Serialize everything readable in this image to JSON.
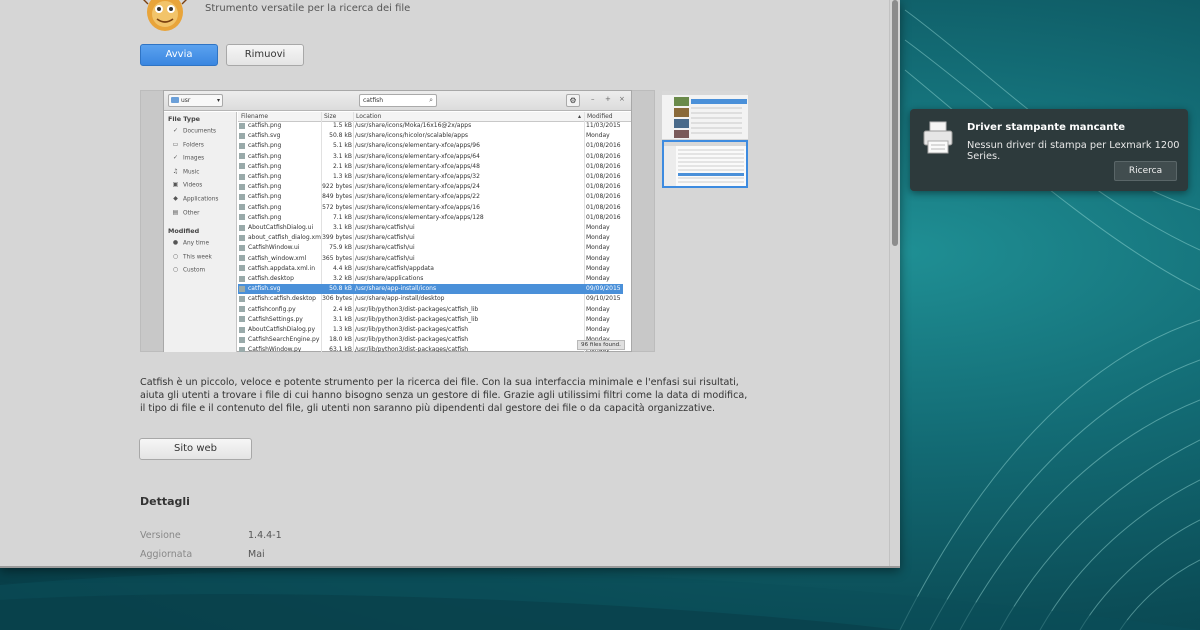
{
  "app": {
    "subtitle": "Strumento versatile per la ricerca dei file",
    "install_label": "Avvia",
    "remove_label": "Rimuovi",
    "website_label": "Sito web",
    "description": "Catfish è un piccolo, veloce e potente strumento per la ricerca dei file. Con la sua interfaccia minimale e l'enfasi sui risultati, aiuta gli utenti a trovare i file di cui hanno bisogno senza un gestore di file. Grazie agli utilissimi filtri come la data di modifica, il tipo di file e il contenuto del file, gli utenti non saranno più dipendenti dal gestore dei file o da capacità organizzative.",
    "details_heading": "Dettagli",
    "details": [
      {
        "label": "Versione",
        "value": "1.4.4-1"
      },
      {
        "label": "Aggiornata",
        "value": "Mai"
      }
    ]
  },
  "screenshot": {
    "location": "usr",
    "search_value": "catfish",
    "sidebar": {
      "file_type_heading": "File Type",
      "file_types": [
        {
          "label": "Documents",
          "icon": "checkbox-checked-icon"
        },
        {
          "label": "Folders",
          "icon": "folder-icon"
        },
        {
          "label": "Images",
          "icon": "checkbox-checked-icon"
        },
        {
          "label": "Music",
          "icon": "music-icon"
        },
        {
          "label": "Videos",
          "icon": "video-icon"
        },
        {
          "label": "Applications",
          "icon": "applications-icon"
        },
        {
          "label": "Other",
          "icon": "other-icon"
        }
      ],
      "modified_heading": "Modified",
      "modified": [
        "Any time",
        "This week",
        "Custom"
      ]
    },
    "columns": [
      "Filename",
      "Size",
      "Location",
      "Modified"
    ],
    "rows": [
      {
        "name": "catfish.png",
        "size": "1.5 kB",
        "location": "/usr/share/icons/Moka/16x16@2x/apps",
        "modified": "11/03/2015"
      },
      {
        "name": "catfish.svg",
        "size": "50.8 kB",
        "location": "/usr/share/icons/hicolor/scalable/apps",
        "modified": "Monday"
      },
      {
        "name": "catfish.png",
        "size": "5.1 kB",
        "location": "/usr/share/icons/elementary-xfce/apps/96",
        "modified": "01/08/2016"
      },
      {
        "name": "catfish.png",
        "size": "3.1 kB",
        "location": "/usr/share/icons/elementary-xfce/apps/64",
        "modified": "01/08/2016"
      },
      {
        "name": "catfish.png",
        "size": "2.1 kB",
        "location": "/usr/share/icons/elementary-xfce/apps/48",
        "modified": "01/08/2016"
      },
      {
        "name": "catfish.png",
        "size": "1.3 kB",
        "location": "/usr/share/icons/elementary-xfce/apps/32",
        "modified": "01/08/2016"
      },
      {
        "name": "catfish.png",
        "size": "922 bytes",
        "location": "/usr/share/icons/elementary-xfce/apps/24",
        "modified": "01/08/2016"
      },
      {
        "name": "catfish.png",
        "size": "849 bytes",
        "location": "/usr/share/icons/elementary-xfce/apps/22",
        "modified": "01/08/2016"
      },
      {
        "name": "catfish.png",
        "size": "572 bytes",
        "location": "/usr/share/icons/elementary-xfce/apps/16",
        "modified": "01/08/2016"
      },
      {
        "name": "catfish.png",
        "size": "7.1 kB",
        "location": "/usr/share/icons/elementary-xfce/apps/128",
        "modified": "01/08/2016"
      },
      {
        "name": "AboutCatfishDialog.ui",
        "size": "3.1 kB",
        "location": "/usr/share/catfish/ui",
        "modified": "Monday"
      },
      {
        "name": "about_catfish_dialog.xml",
        "size": "399 bytes",
        "location": "/usr/share/catfish/ui",
        "modified": "Monday"
      },
      {
        "name": "CatfishWindow.ui",
        "size": "75.9 kB",
        "location": "/usr/share/catfish/ui",
        "modified": "Monday"
      },
      {
        "name": "catfish_window.xml",
        "size": "365 bytes",
        "location": "/usr/share/catfish/ui",
        "modified": "Monday"
      },
      {
        "name": "catfish.appdata.xml.in",
        "size": "4.4 kB",
        "location": "/usr/share/catfish/appdata",
        "modified": "Monday"
      },
      {
        "name": "catfish.desktop",
        "size": "3.2 kB",
        "location": "/usr/share/applications",
        "modified": "Monday"
      },
      {
        "name": "catfish.svg",
        "size": "50.8 kB",
        "location": "/usr/share/app-install/icons",
        "modified": "09/09/2015",
        "selected": true
      },
      {
        "name": "catfish:catfish.desktop",
        "size": "306 bytes",
        "location": "/usr/share/app-install/desktop",
        "modified": "09/10/2015"
      },
      {
        "name": "catfishconfig.py",
        "size": "2.4 kB",
        "location": "/usr/lib/python3/dist-packages/catfish_lib",
        "modified": "Monday"
      },
      {
        "name": "CatfishSettings.py",
        "size": "3.1 kB",
        "location": "/usr/lib/python3/dist-packages/catfish_lib",
        "modified": "Monday"
      },
      {
        "name": "AboutCatfishDialog.py",
        "size": "1.3 kB",
        "location": "/usr/lib/python3/dist-packages/catfish",
        "modified": "Monday"
      },
      {
        "name": "CatfishSearchEngine.py",
        "size": "18.0 kB",
        "location": "/usr/lib/python3/dist-packages/catfish",
        "modified": "Monday"
      },
      {
        "name": "CatfishWindow.py",
        "size": "63.1 kB",
        "location": "/usr/lib/python3/dist-packages/catfish",
        "modified": "Monday"
      }
    ],
    "status": "96 files found."
  },
  "notification": {
    "title": "Driver stampante mancante",
    "body": "Nessun driver di stampa per Lexmark 1200 Series.",
    "action_label": "Ricerca",
    "icon": "printer-icon"
  },
  "colors": {
    "accent": "#3a86e0",
    "window_bg": "#d6d6d6",
    "desktop": "#136c75",
    "notification_bg": "#2d3a3c"
  }
}
